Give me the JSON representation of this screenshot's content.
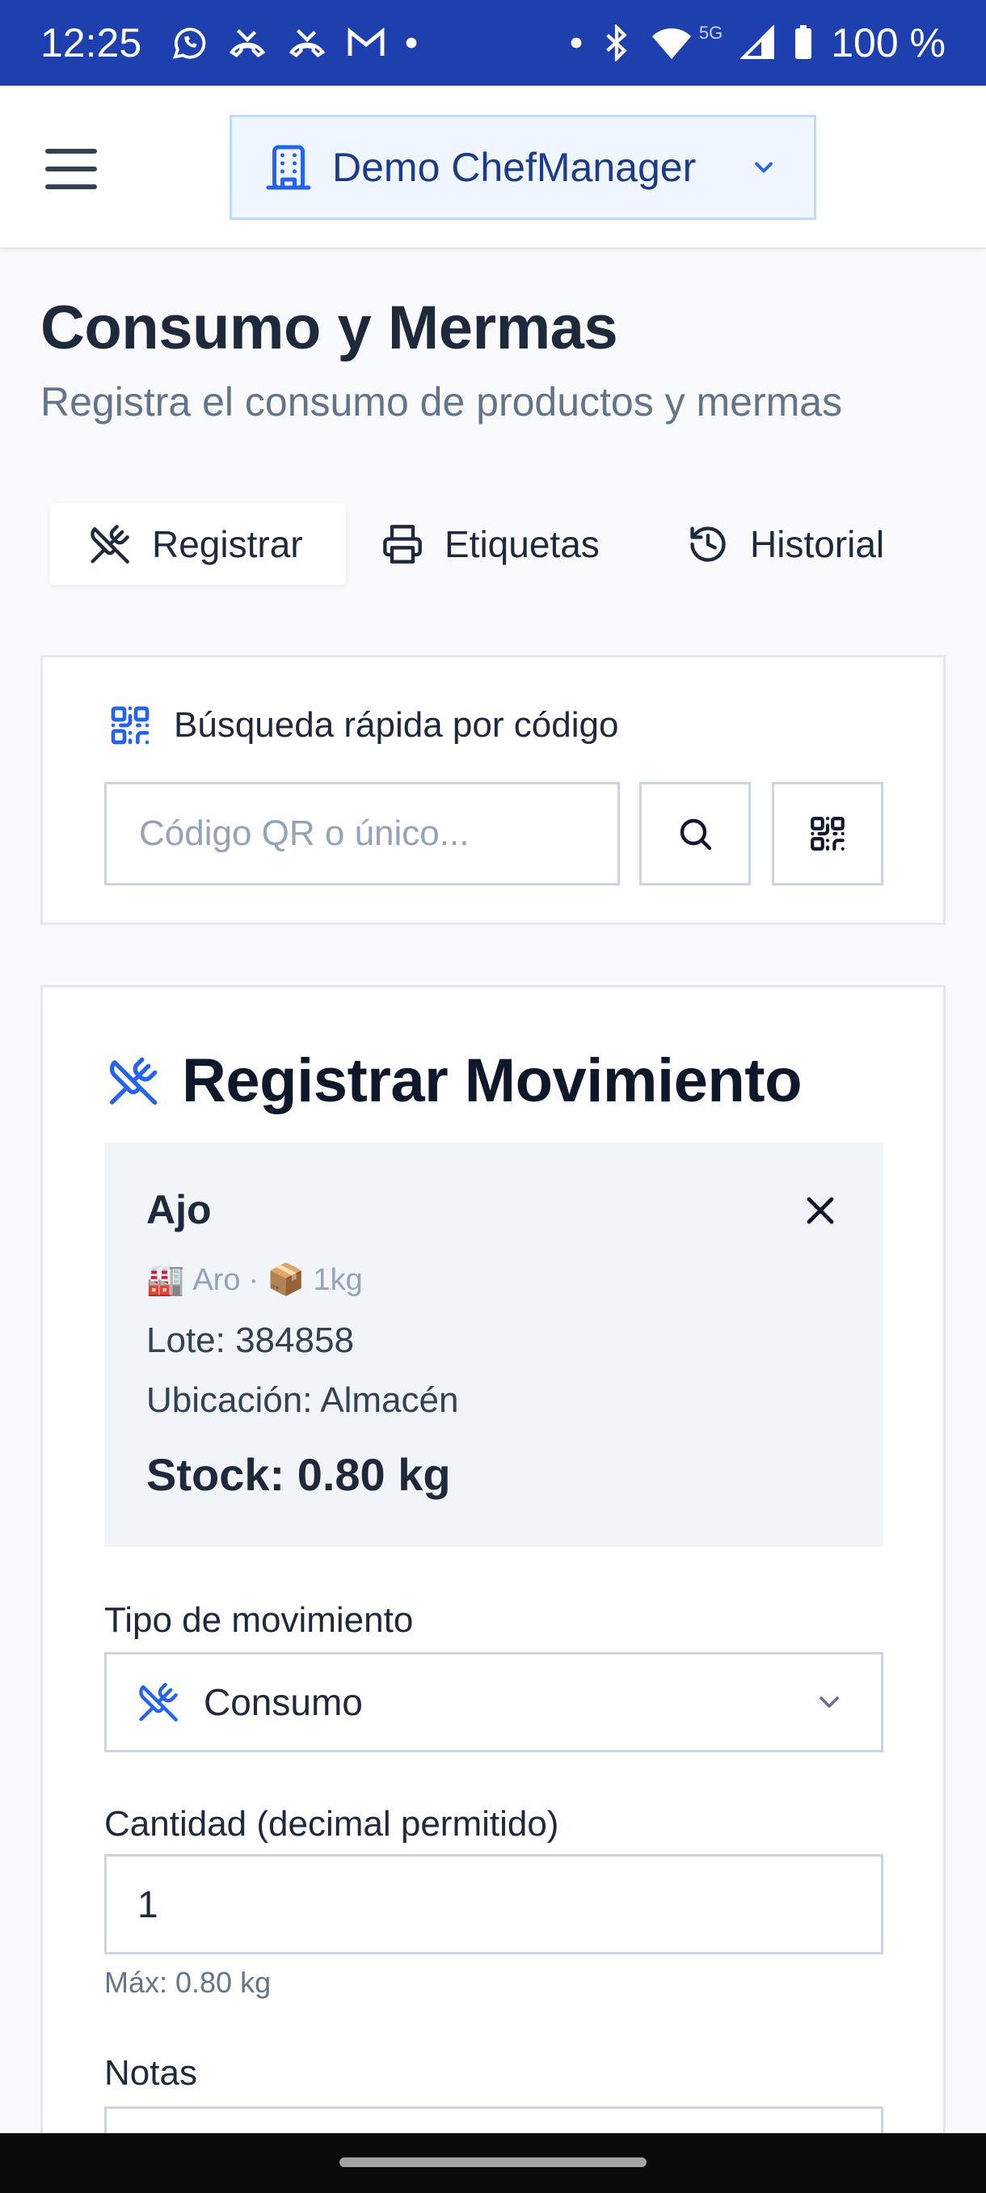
{
  "status_bar": {
    "time": "12:25",
    "network_label": "5G",
    "battery": "100 %"
  },
  "header": {
    "tenant_name": "Demo ChefManager"
  },
  "page": {
    "title": "Consumo y Mermas",
    "subtitle": "Registra el consumo de productos y mermas"
  },
  "tabs": [
    {
      "label": "Registrar",
      "icon": "utensils-crossed-icon",
      "active": true
    },
    {
      "label": "Etiquetas",
      "icon": "printer-icon",
      "active": false
    },
    {
      "label": "Historial",
      "icon": "history-icon",
      "active": false
    }
  ],
  "quick_search": {
    "title": "Búsqueda rápida por código",
    "placeholder": "Código QR o único...",
    "value": ""
  },
  "register": {
    "title": "Registrar Movimiento",
    "product": {
      "name": "Ajo",
      "supplier_emoji": "🏭",
      "supplier": "Aro",
      "separator": "·",
      "package_emoji": "📦",
      "package": "1kg",
      "lot": "Lote: 384858",
      "location": "Ubicación: Almacén",
      "stock": "Stock: 0.80 kg"
    },
    "movement_type_label": "Tipo de movimiento",
    "movement_type_value": "Consumo",
    "quantity_label": "Cantidad (decimal permitido)",
    "quantity_value": "1",
    "quantity_help": "Máx: 0.80 kg",
    "notes_label": "Notas"
  },
  "colors": {
    "status_bar": "#1e40af",
    "accent": "#2563eb",
    "text": "#1e293b",
    "muted": "#64748b"
  }
}
